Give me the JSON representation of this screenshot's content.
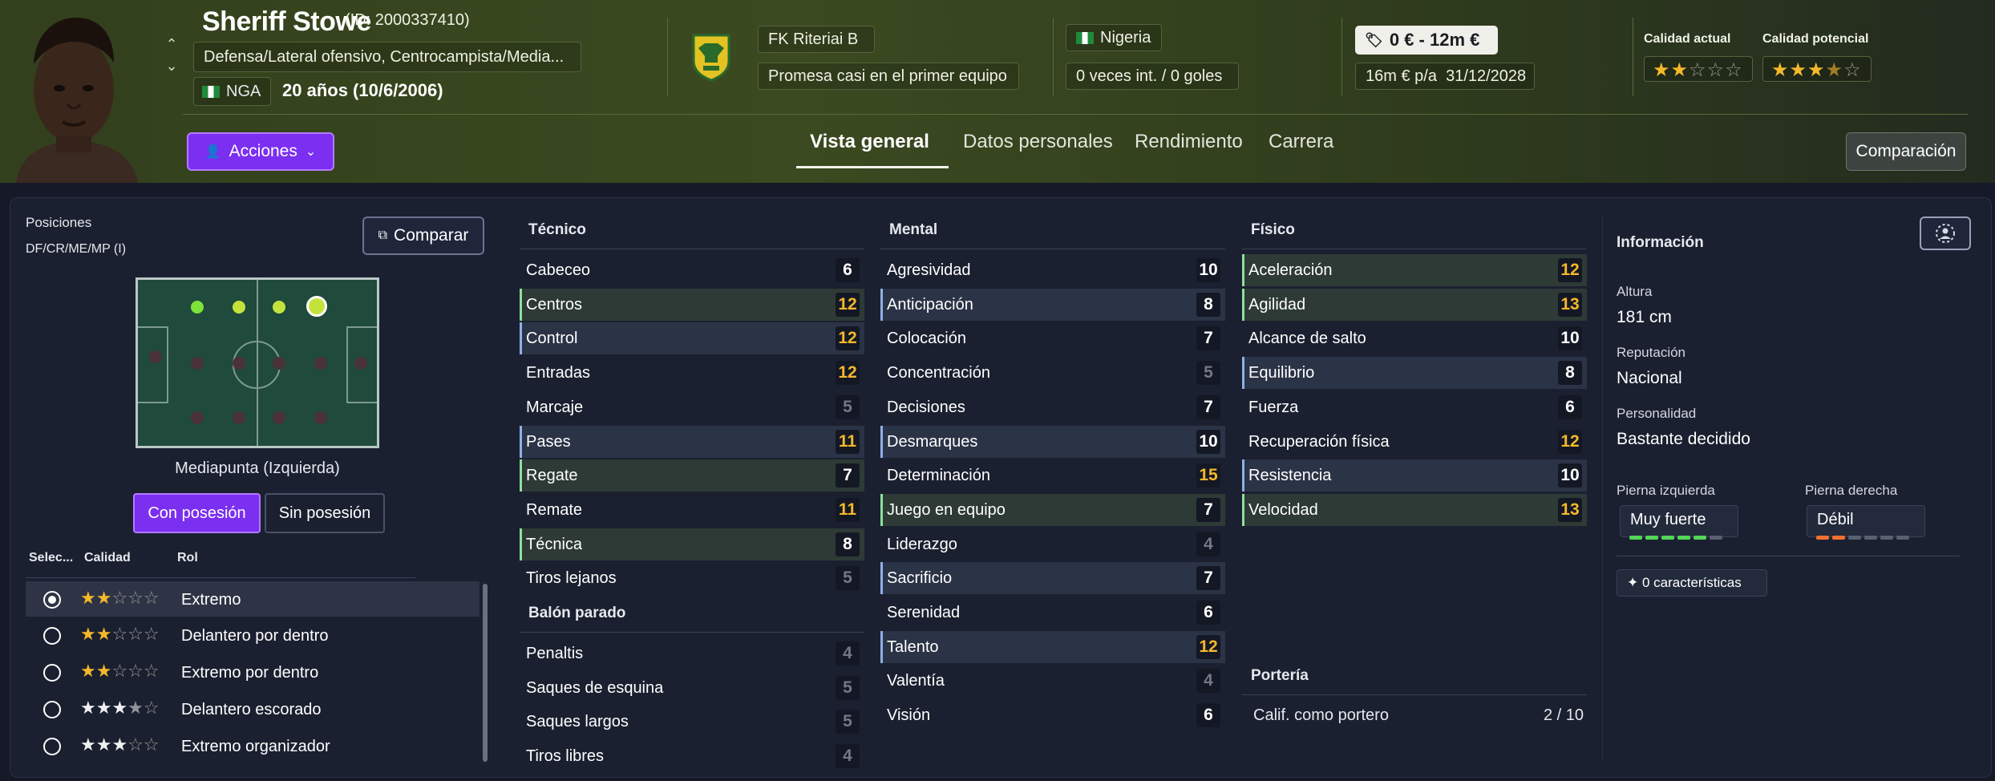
{
  "player": {
    "name": "Sheriff Stowe",
    "id": "(ID: 2000337410)",
    "positions": "Defensa/Lateral ofensivo, Centrocampista/Media...",
    "nationality_code": "NGA",
    "age": "20 años (10/6/2006)"
  },
  "club": {
    "name": "FK Riteriai B",
    "status": "Promesa casi en el primer equipo"
  },
  "country": {
    "name": "Nigeria",
    "intl": "0 veces int. / 0 goles"
  },
  "contract": {
    "value_range": "0 € - 12m €",
    "wage": "16m € p/a",
    "expiry": "31/12/2028"
  },
  "quality": {
    "current_label": "Calidad actual",
    "current_stars": 2,
    "potential_label": "Calidad potencial",
    "potential_stars": 3.5
  },
  "actions": {
    "acciones_label": "Acciones",
    "comparacion_label": "Comparación"
  },
  "tabs": [
    {
      "label": "Vista general",
      "active": true
    },
    {
      "label": "Datos personales",
      "active": false
    },
    {
      "label": "Rendimiento",
      "active": false
    },
    {
      "label": "Carrera",
      "active": false
    }
  ],
  "left": {
    "posiciones_label": "Posiciones",
    "posiciones_value": "DF/CR/ME/MP (I)",
    "comparar_label": "Comparar",
    "position_name": "Mediapunta (Izquierda)",
    "con_posesion": "Con posesión",
    "sin_posesion": "Sin posesión",
    "col_select": "Selec...",
    "col_calidad": "Calidad",
    "col_rol": "Rol",
    "roles": [
      {
        "name": "Extremo",
        "stars": 2,
        "selected": true
      },
      {
        "name": "Delantero por dentro",
        "stars": 2,
        "selected": false
      },
      {
        "name": "Extremo por dentro",
        "stars": 2,
        "selected": false
      },
      {
        "name": "Delantero escorado",
        "stars": 3.5,
        "selected": false
      },
      {
        "name": "Extremo organizador",
        "stars": 3,
        "selected": false
      }
    ]
  },
  "tecnico": {
    "title": "Técnico",
    "attrs": [
      {
        "name": "Cabeceo",
        "value": 6,
        "hl": ""
      },
      {
        "name": "Centros",
        "value": 12,
        "hl": "g"
      },
      {
        "name": "Control",
        "value": 12,
        "hl": "b"
      },
      {
        "name": "Entradas",
        "value": 12,
        "hl": ""
      },
      {
        "name": "Marcaje",
        "value": 5,
        "hl": ""
      },
      {
        "name": "Pases",
        "value": 11,
        "hl": "b"
      },
      {
        "name": "Regate",
        "value": 7,
        "hl": "g"
      },
      {
        "name": "Remate",
        "value": 11,
        "hl": ""
      },
      {
        "name": "Técnica",
        "value": 8,
        "hl": "g"
      },
      {
        "name": "Tiros lejanos",
        "value": 5,
        "hl": ""
      }
    ]
  },
  "balon_parado": {
    "title": "Balón parado",
    "attrs": [
      {
        "name": "Penaltis",
        "value": 4,
        "hl": ""
      },
      {
        "name": "Saques de esquina",
        "value": 5,
        "hl": ""
      },
      {
        "name": "Saques largos",
        "value": 5,
        "hl": ""
      },
      {
        "name": "Tiros libres",
        "value": 4,
        "hl": ""
      }
    ]
  },
  "mental": {
    "title": "Mental",
    "attrs": [
      {
        "name": "Agresividad",
        "value": 10,
        "hl": ""
      },
      {
        "name": "Anticipación",
        "value": 8,
        "hl": "b"
      },
      {
        "name": "Colocación",
        "value": 7,
        "hl": ""
      },
      {
        "name": "Concentración",
        "value": 5,
        "hl": ""
      },
      {
        "name": "Decisiones",
        "value": 7,
        "hl": ""
      },
      {
        "name": "Desmarques",
        "value": 10,
        "hl": "b"
      },
      {
        "name": "Determinación",
        "value": 15,
        "hl": ""
      },
      {
        "name": "Juego en equipo",
        "value": 7,
        "hl": "g"
      },
      {
        "name": "Liderazgo",
        "value": 4,
        "hl": ""
      },
      {
        "name": "Sacrificio",
        "value": 7,
        "hl": "b"
      },
      {
        "name": "Serenidad",
        "value": 6,
        "hl": ""
      },
      {
        "name": "Talento",
        "value": 12,
        "hl": "b"
      },
      {
        "name": "Valentía",
        "value": 4,
        "hl": ""
      },
      {
        "name": "Visión",
        "value": 6,
        "hl": ""
      }
    ]
  },
  "fisico": {
    "title": "Físico",
    "attrs": [
      {
        "name": "Aceleración",
        "value": 12,
        "hl": "g"
      },
      {
        "name": "Agilidad",
        "value": 13,
        "hl": "g"
      },
      {
        "name": "Alcance de salto",
        "value": 10,
        "hl": ""
      },
      {
        "name": "Equilibrio",
        "value": 8,
        "hl": "b"
      },
      {
        "name": "Fuerza",
        "value": 6,
        "hl": ""
      },
      {
        "name": "Recuperación física",
        "value": 12,
        "hl": ""
      },
      {
        "name": "Resistencia",
        "value": 10,
        "hl": "b"
      },
      {
        "name": "Velocidad",
        "value": 13,
        "hl": "g"
      }
    ]
  },
  "porteria": {
    "title": "Portería",
    "label": "Calif. como portero",
    "value": "2 / 10"
  },
  "info": {
    "title": "Información",
    "altura_label": "Altura",
    "altura": "181 cm",
    "reputacion_label": "Reputación",
    "reputacion": "Nacional",
    "personalidad_label": "Personalidad",
    "personalidad": "Bastante decidido",
    "pierna_izq_label": "Pierna izquierda",
    "pierna_izq": "Muy fuerte",
    "pierna_izq_level": 5,
    "pierna_der_label": "Pierna derecha",
    "pierna_der": "Débil",
    "pierna_der_level": 2,
    "caracteristicas": "0 características"
  },
  "colors": {
    "accent": "#7b2ff0",
    "gold": "#f4b82b",
    "green_foot": "#54d45a",
    "orange_foot": "#f07030"
  }
}
